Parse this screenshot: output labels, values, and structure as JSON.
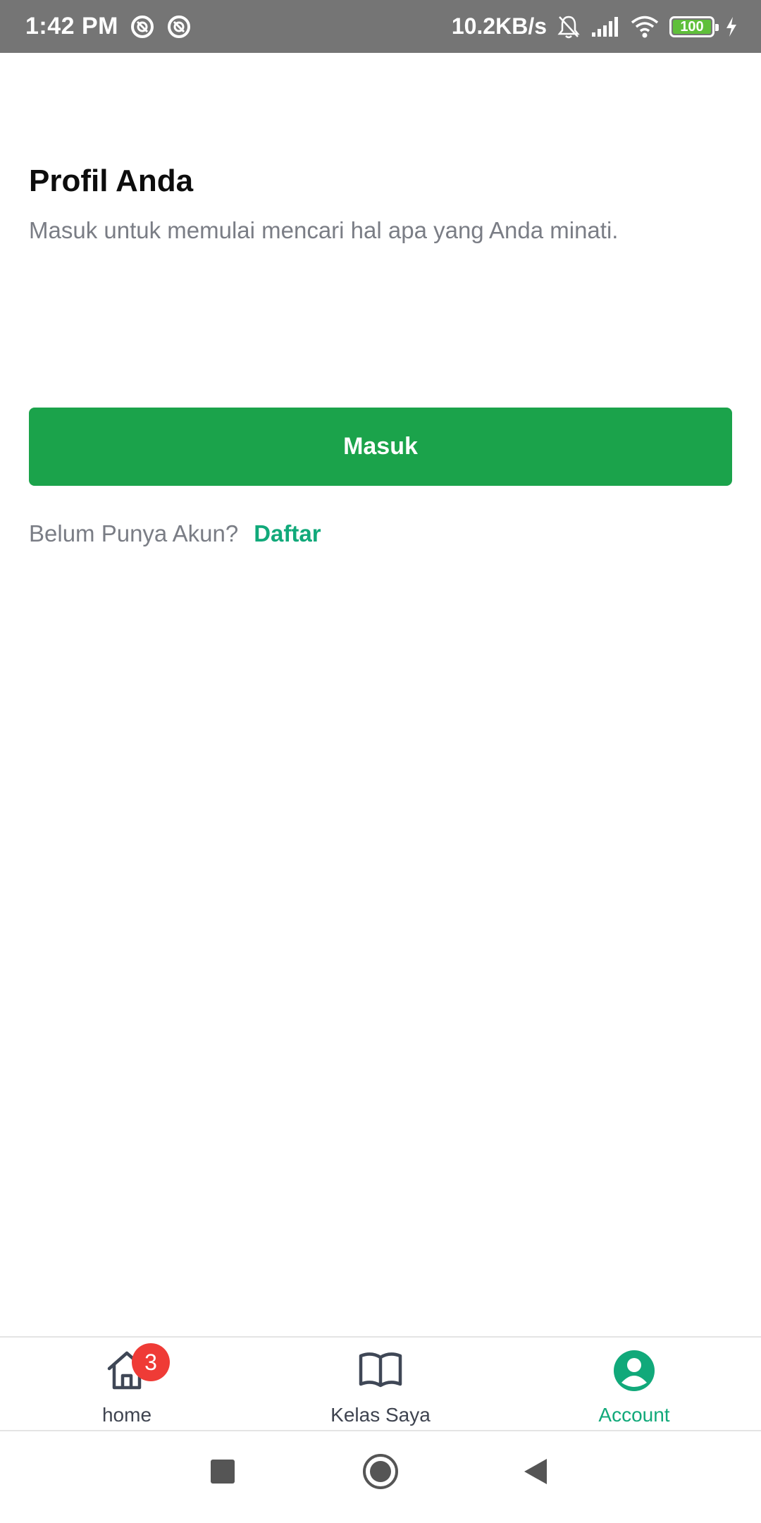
{
  "status_bar": {
    "time": "1:42 PM",
    "network_speed": "10.2KB/s",
    "battery": "100",
    "icons": [
      "sync-icon",
      "sync-icon",
      "bell-muted-icon",
      "signal-icon",
      "wifi-icon",
      "battery-icon",
      "charging-icon"
    ]
  },
  "profile": {
    "title": "Profil Anda",
    "subtitle": "Masuk untuk memulai mencari hal apa yang Anda minati.",
    "login_button": "Masuk",
    "register_prompt": "Belum Punya Akun?",
    "register_link": "Daftar"
  },
  "bottom_nav": {
    "items": [
      {
        "label": "home",
        "icon": "home-icon",
        "badge": "3",
        "active": false
      },
      {
        "label": "Kelas Saya",
        "icon": "book-icon",
        "active": false
      },
      {
        "label": "Account",
        "icon": "account-icon",
        "active": true
      }
    ]
  },
  "system_nav": {
    "icons": [
      "recent-apps-icon",
      "home-button-icon",
      "back-icon"
    ]
  },
  "colors": {
    "primary_green": "#1ba34b",
    "accent_teal": "#11a97a",
    "badge_red": "#ef3b36",
    "status_bar": "#757575",
    "muted_text": "#7a7d85"
  }
}
